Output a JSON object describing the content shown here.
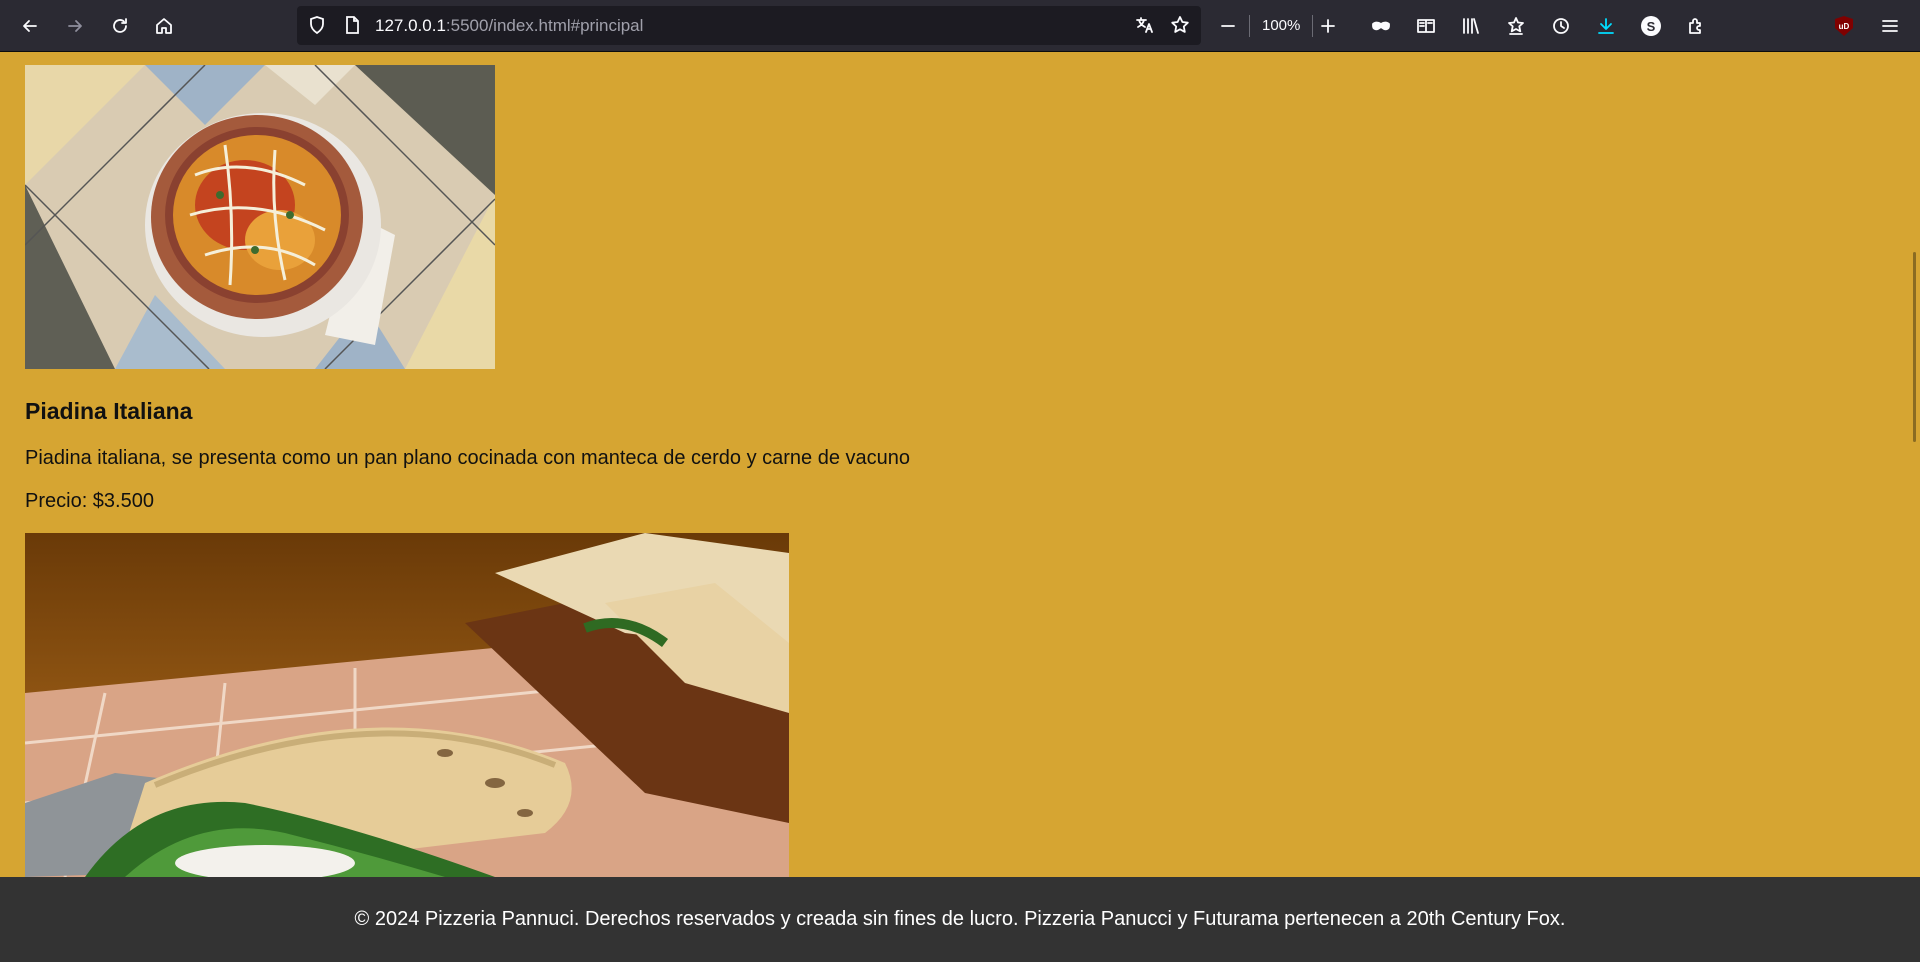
{
  "browser": {
    "url_host": "127.0.0.1",
    "url_rest": ":5500/index.html#principal",
    "zoom": "100%"
  },
  "toolbar_icons": [
    "back-icon",
    "forward-icon",
    "reload-icon",
    "home-icon",
    "shield-icon",
    "page-icon",
    "translate-icon",
    "bookmark-star-icon",
    "zoom-out-icon",
    "zoom-in-icon",
    "private-mask-icon",
    "reader-view-icon",
    "library-icon",
    "bookmarks-icon",
    "history-icon",
    "download-icon",
    "skype-icon",
    "extensions-icon",
    "ublock-icon",
    "menu-icon"
  ],
  "extension_labels": {
    "skype": "S",
    "ublock": "uD"
  },
  "menu": {
    "item": {
      "title": "Piadina Italiana",
      "description": "Piadina italiana, se presenta como un pan plano cocinada con manteca de cerdo y carne de vacuno",
      "price": "Precio: $3.500"
    }
  },
  "footer": {
    "text": "© 2024 Pizzeria Pannuci. Derechos reservados y creada sin fines de lucro. Pizzeria Panucci y Futurama pertenecen a 20th Century Fox."
  },
  "colors": {
    "page_background": "#d6a532",
    "footer_background": "#333333",
    "toolbar_background": "#2b2a33",
    "download_accent": "#00ddff"
  }
}
